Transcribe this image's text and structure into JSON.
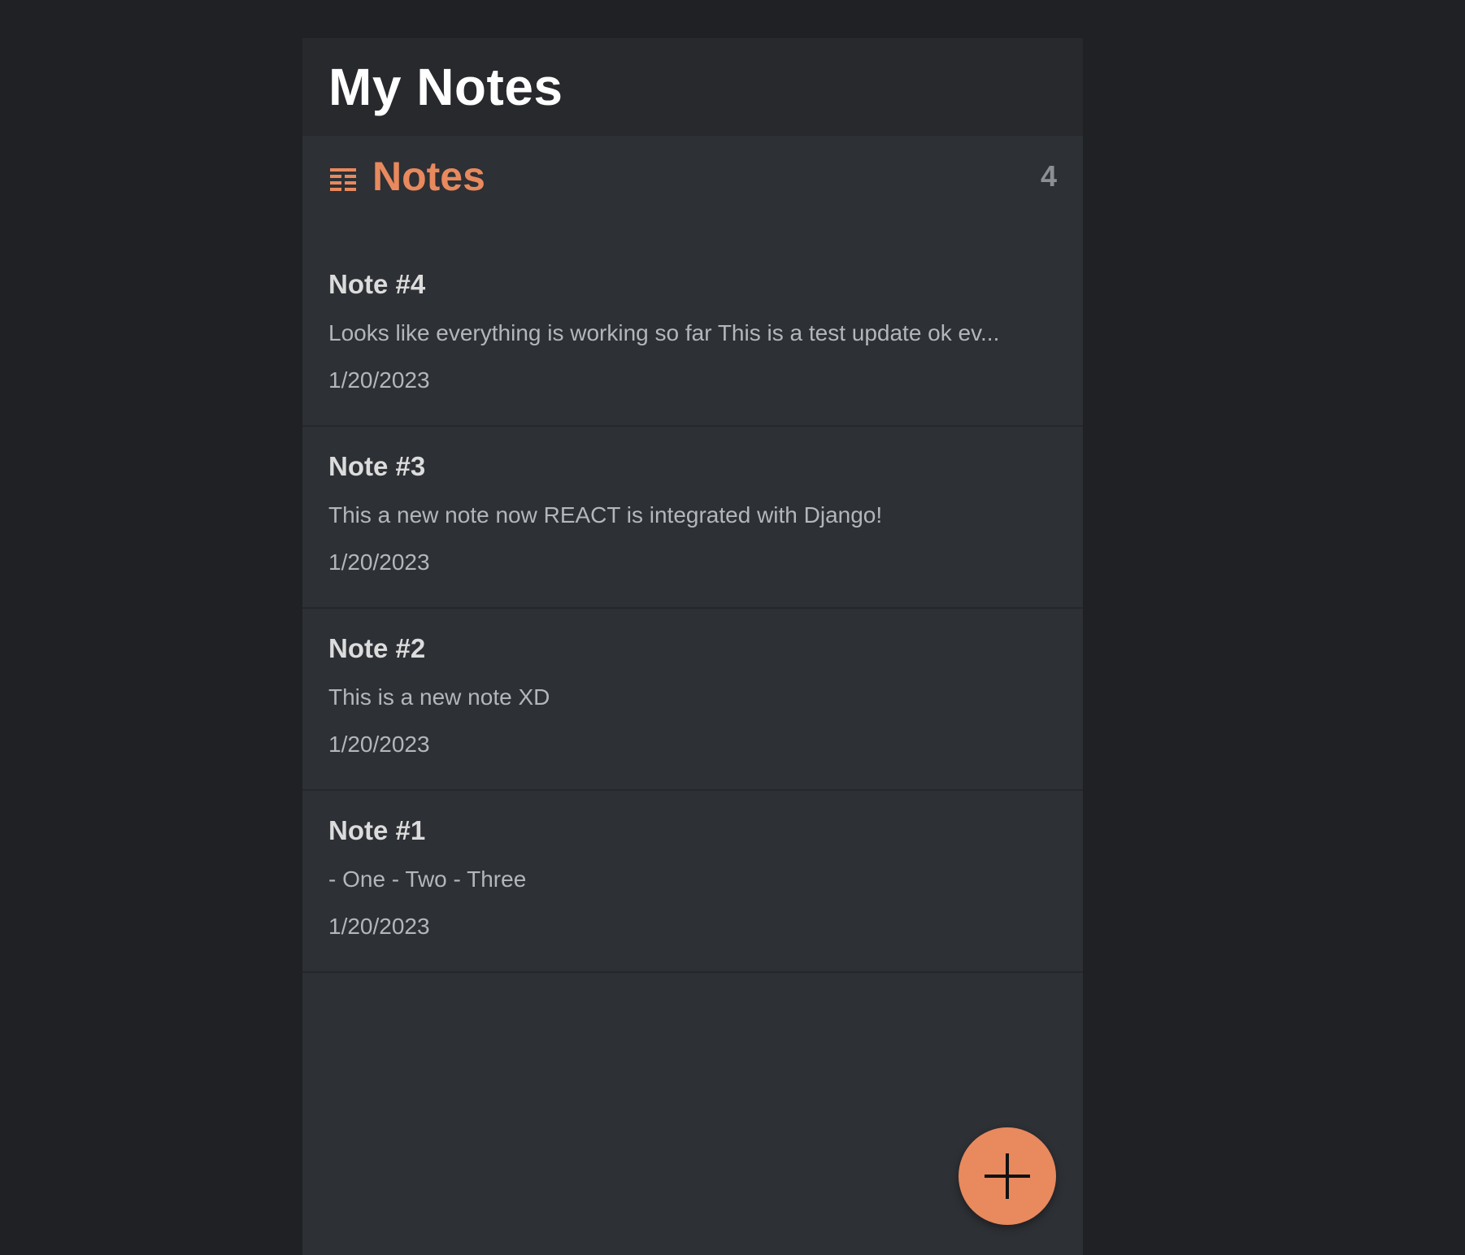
{
  "app": {
    "title": "My Notes"
  },
  "notes_header": {
    "icon": "list-icon",
    "title": "Notes",
    "count": "4"
  },
  "notes": [
    {
      "title": "Note #4",
      "preview": "Looks like everything is working so far This is a test update ok ev...",
      "date": "1/20/2023"
    },
    {
      "title": "Note #3",
      "preview": "This a new note now REACT is integrated with Django!",
      "date": "1/20/2023"
    },
    {
      "title": "Note #2",
      "preview": "This is a new note XD",
      "date": "1/20/2023"
    },
    {
      "title": "Note #1",
      "preview": "- One - Two - Three",
      "date": "1/20/2023"
    }
  ],
  "add_button": {
    "icon": "plus-icon"
  },
  "colors": {
    "accent": "#e8895e",
    "page_background": "#1f2124",
    "panel_background": "#2d3034",
    "header_background": "#27292c"
  }
}
